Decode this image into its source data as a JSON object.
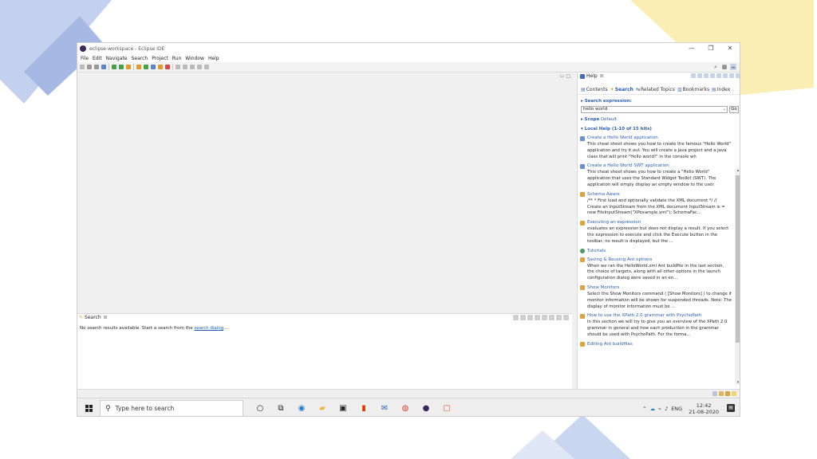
{
  "window": {
    "title": "eclipse-workspace - Eclipse IDE",
    "controls": {
      "minimize": "—",
      "restore": "❐",
      "close": "✕"
    }
  },
  "menu": [
    "File",
    "Edit",
    "Navigate",
    "Search",
    "Project",
    "Run",
    "Window",
    "Help"
  ],
  "editor": {
    "min_label": "▭",
    "max_label": "□"
  },
  "search_view": {
    "tab_label": "Search",
    "tab_close": "⊠",
    "message_prefix": "No search results available. Start a search from the ",
    "message_link": "search dialog",
    "message_suffix": "..."
  },
  "help_view": {
    "tab_label": "Help",
    "tab_close": "⊠",
    "nav": {
      "contents": "Contents",
      "search": "Search",
      "related": "Related Topics",
      "bookmarks": "Bookmarks",
      "index": "Index"
    },
    "search_label": "Search expression:",
    "search_value": "hello world",
    "go_label": "Go",
    "scope_label": "Scope",
    "scope_value": "Default",
    "local_help_header": "Local Help (1-10 of 15 hits)",
    "results": [
      {
        "title": "Create a Hello World application",
        "icon": "cheatsheet-icon",
        "desc": "This cheat sheet shows you how to create the famous \"Hello World\" application and try it out. You will create a Java project and a Java class that will print \"Hello world!\" in the console wh"
      },
      {
        "title": "Create a Hello World SWT application",
        "icon": "cheatsheet-icon",
        "desc": "This cheat sheet shows you how to create a \"Hello World\" application that uses the Standard Widget Toolkit (SWT). The application will simply display an empty window to the user."
      },
      {
        "title": "Schema Aware",
        "icon": "ant-icon",
        "desc": "/** * First load and optionally validate the XML document */ // Create an InputStream from the XML document InputStream is = new FileInputStream(\"XPexample.xml\"); SchemaFac..."
      },
      {
        "title": "Executing an expression",
        "icon": "ant-icon",
        "desc": "evaluates an expression but does not display a result. If you select the expression to execute and click the Execute button in the toolbar, no result is displayed, but the ..."
      },
      {
        "title": "Tutorials",
        "icon": "globe-icon",
        "desc": ""
      },
      {
        "title": "Saving & Reusing Ant options",
        "icon": "ant-icon",
        "desc": "When we ran the HelloWorld.xml Ant buildfile in the last section, the choice of targets, along with all other options in the launch configuration dialog were saved in an en..."
      },
      {
        "title": "Show Monitors",
        "icon": "ant-icon",
        "desc": "Select the Show Monitors command ( [Show Monitors] ) to change if monitor information will be shown for suspended threads. Note: The display of monitor information must be ..."
      },
      {
        "title": "How to use the XPath 2.0 grammar with PsychoPath",
        "icon": "ant-icon",
        "desc": "In this section we will try to give you an overview of the XPath 2.0 grammar in general and how each production in the grammar should be used with PsychoPath. For the forma..."
      },
      {
        "title": "Editing Ant buildfiles",
        "icon": "ant-icon",
        "desc": ""
      }
    ]
  },
  "taskbar": {
    "search_placeholder": "Type here to search",
    "time": "12:42",
    "date": "21-08-2020",
    "language": "ENG"
  },
  "colors": {
    "accent": "#2a5db0",
    "deco_blue": "#a9bde6",
    "deco_yellow": "#f9e9a6"
  }
}
